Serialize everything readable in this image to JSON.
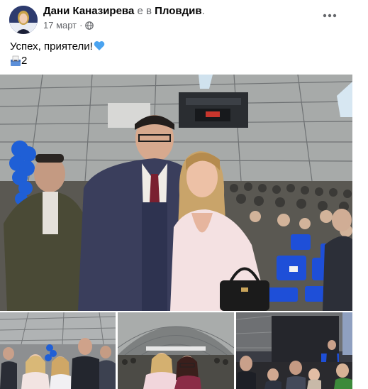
{
  "post": {
    "author_name": "Дани Каназирева",
    "author_connector": " е в ",
    "author_location": "Пловдив",
    "author_suffix": ".",
    "date": "17 март",
    "date_separator": "·",
    "privacy_icon": "globe-icon",
    "more_icon": "more-horizontal-icon",
    "text": "Успех, приятели!",
    "text_emoji_icon": "blue-heart-icon",
    "ballot_emoji_icon": "ballot-box-icon",
    "ballot_number": "2"
  },
  "photos": {
    "main_alt": "",
    "thumbnails": 3
  },
  "colors": {
    "heart_blue": "#4aa3f0",
    "meta_gray": "#65676b",
    "text": "#050505",
    "balloon_blue": "#1f5fd6",
    "chair_blue": "#1e4fd8"
  }
}
